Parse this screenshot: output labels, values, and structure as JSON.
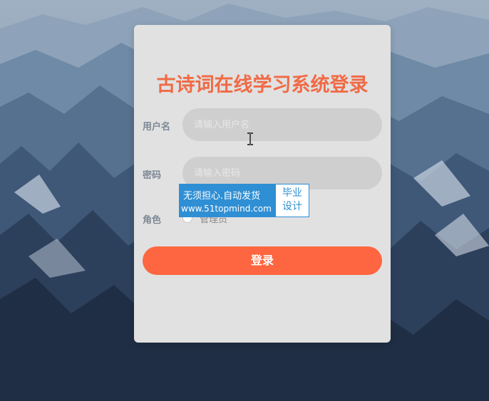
{
  "login": {
    "title": "古诗词在线学习系统登录",
    "username_label": "用户名",
    "username_placeholder": "请输入用户名",
    "password_label": "密码",
    "password_placeholder": "请输入密码",
    "role_label": "角色",
    "role_option": "管理员",
    "submit_label": "登录"
  },
  "watermark": {
    "line1": "无须担心.自动发货",
    "line2": "www.51topmind.com",
    "badge_line1": "毕业",
    "badge_line2": "设计"
  },
  "colors": {
    "title": "#f06a45",
    "button": "#fd6640",
    "panel": "#e1e1e1",
    "input_bg": "#cfcfcf",
    "watermark": "#2f8fd4"
  }
}
